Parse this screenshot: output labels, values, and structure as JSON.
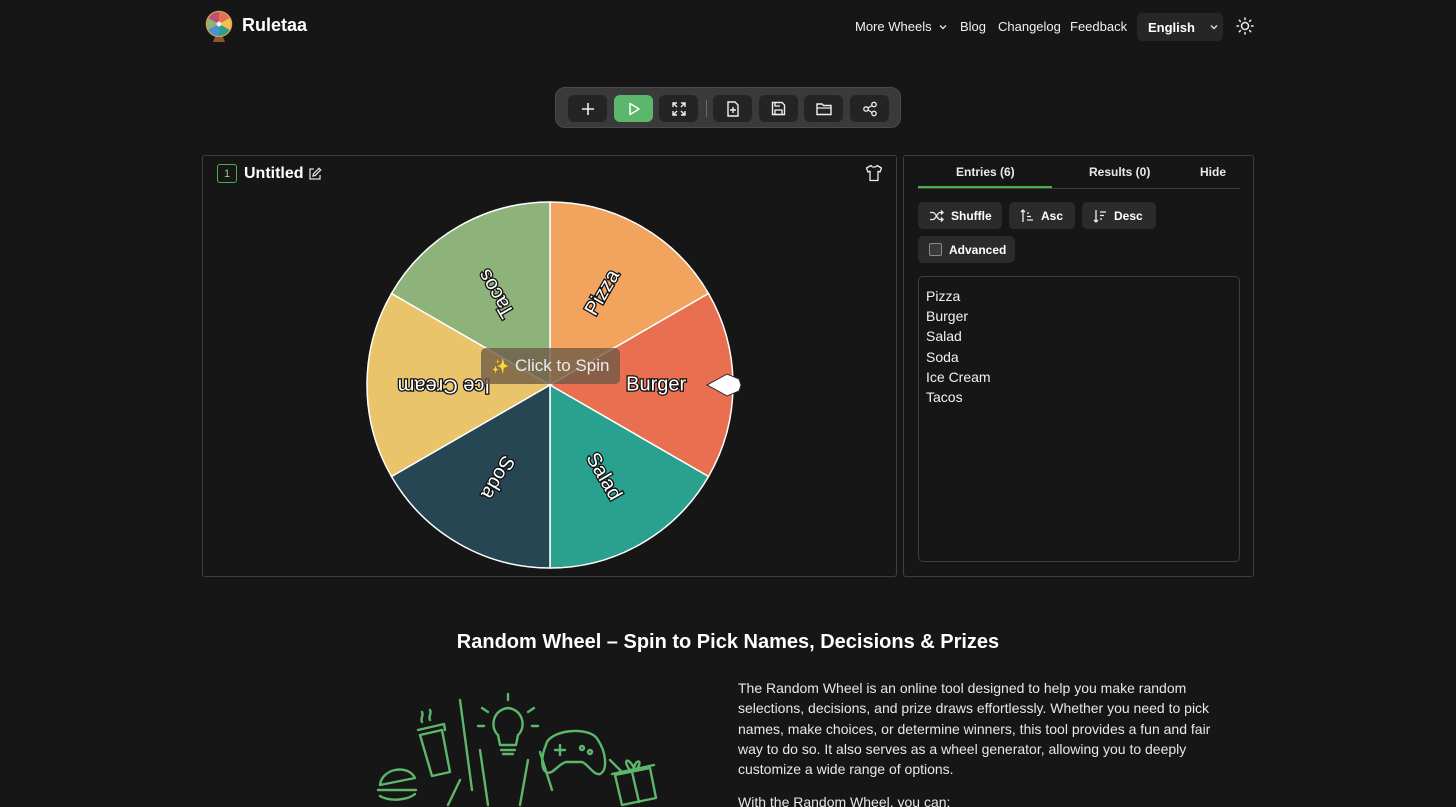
{
  "header": {
    "brand": "Ruletaa",
    "nav": {
      "more_wheels": "More Wheels",
      "blog": "Blog",
      "changelog": "Changelog",
      "feedback": "Feedback"
    },
    "language": "English"
  },
  "toolbar": {
    "buttons": [
      "add-icon",
      "play-icon",
      "fullscreen-icon",
      "new-file-icon",
      "save-icon",
      "open-folder-icon",
      "share-icon"
    ]
  },
  "wheel": {
    "number": "1",
    "title": "Untitled",
    "spin_label": "Click to Spin",
    "spin_emoji": "✨",
    "segments": [
      {
        "label": "Pizza",
        "color": "#f2a35e"
      },
      {
        "label": "Burger",
        "color": "#e86f50"
      },
      {
        "label": "Salad",
        "color": "#2aa08f"
      },
      {
        "label": "Soda",
        "color": "#264653"
      },
      {
        "label": "Ice Cream",
        "color": "#e9c46a"
      },
      {
        "label": "Tacos",
        "color": "#8db37a"
      }
    ]
  },
  "entries_panel": {
    "tabs": {
      "entries": "Entries (6)",
      "results": "Results (0)",
      "hide": "Hide"
    },
    "actions": {
      "shuffle": "Shuffle",
      "asc": "Asc",
      "desc": "Desc",
      "advanced": "Advanced"
    },
    "entries": [
      "Pizza",
      "Burger",
      "Salad",
      "Soda",
      "Ice Cream",
      "Tacos"
    ],
    "accent": "#4caf50"
  },
  "content": {
    "title": "Random Wheel – Spin to Pick Names, Decisions & Prizes",
    "paragraph": "The Random Wheel is an online tool designed to help you make random selections, decisions, and prize draws effortlessly. Whether you need to pick names, make choices, or determine winners, this tool provides a fun and fair way to do so. It also serves as a wheel generator, allowing you to deeply customize a wide range of options.",
    "paragraph2": "With the Random Wheel, you can:"
  }
}
